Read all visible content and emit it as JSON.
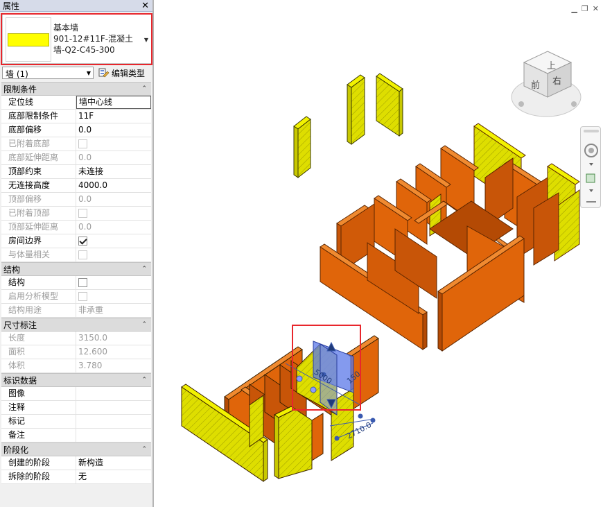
{
  "panel": {
    "title": "属性",
    "close_glyph": "✕",
    "type_selector": {
      "family": "基本墙",
      "type_name": "901-12#11F-混凝土墙-Q2-C45-300",
      "swatch_color": "#ffff00"
    },
    "instance_filter": "墙 (1)",
    "edit_type_label": "编辑类型",
    "groups": [
      {
        "name": "限制条件",
        "rows": [
          {
            "name": "定位线",
            "value": "墙中心线",
            "editing": true
          },
          {
            "name": "底部限制条件",
            "value": "11F"
          },
          {
            "name": "底部偏移",
            "value": "0.0"
          },
          {
            "name": "已附着底部",
            "checkbox": false,
            "disabled": true
          },
          {
            "name": "底部延伸距离",
            "value": "0.0",
            "disabled": true
          },
          {
            "name": "顶部约束",
            "value": "未连接"
          },
          {
            "name": "无连接高度",
            "value": "4000.0"
          },
          {
            "name": "顶部偏移",
            "value": "0.0",
            "disabled": true
          },
          {
            "name": "已附着顶部",
            "checkbox": false,
            "disabled": true
          },
          {
            "name": "顶部延伸距离",
            "value": "0.0",
            "disabled": true
          },
          {
            "name": "房间边界",
            "checkbox": true
          },
          {
            "name": "与体量相关",
            "checkbox": false,
            "disabled": true
          }
        ]
      },
      {
        "name": "结构",
        "rows": [
          {
            "name": "结构",
            "checkbox": false
          },
          {
            "name": "启用分析模型",
            "checkbox": false,
            "disabled": true
          },
          {
            "name": "结构用途",
            "value": "非承重",
            "disabled": true
          }
        ]
      },
      {
        "name": "尺寸标注",
        "rows": [
          {
            "name": "长度",
            "value": "3150.0",
            "disabled": true
          },
          {
            "name": "面积",
            "value": "12.600",
            "disabled": true
          },
          {
            "name": "体积",
            "value": "3.780",
            "disabled": true
          }
        ]
      },
      {
        "name": "标识数据",
        "rows": [
          {
            "name": "图像",
            "value": ""
          },
          {
            "name": "注释",
            "value": ""
          },
          {
            "name": "标记",
            "value": ""
          },
          {
            "name": "备注",
            "value": ""
          }
        ]
      },
      {
        "name": "阶段化",
        "rows": [
          {
            "name": "创建的阶段",
            "value": "新构造"
          },
          {
            "name": "拆除的阶段",
            "value": "无"
          }
        ]
      }
    ]
  },
  "view": {
    "viewcube_faces": {
      "top": "上",
      "front": "前",
      "right": "右"
    },
    "dimensions": [
      "2710.0",
      "5000",
      "150"
    ],
    "colors": {
      "wall_orange": "#e0650a",
      "wall_yellow": "#d8d800",
      "selection_blue": "#5b78e8",
      "highlight_red": "#e8262c"
    }
  }
}
